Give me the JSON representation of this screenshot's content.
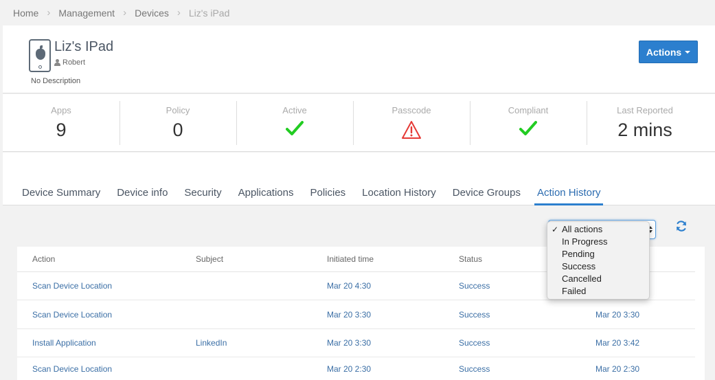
{
  "breadcrumb": [
    "Home",
    "Management",
    "Devices",
    "Liz's iPad"
  ],
  "device": {
    "name": "Liz's IPad",
    "owner": "Robert",
    "description": "No Description"
  },
  "actions_button": "Actions",
  "stats": [
    {
      "label": "Apps",
      "value": "9"
    },
    {
      "label": "Policy",
      "value": "0"
    },
    {
      "label": "Active",
      "icon": "green-check-icon"
    },
    {
      "label": "Passcode",
      "icon": "warning-triangle-icon"
    },
    {
      "label": "Compliant",
      "icon": "green-check-icon"
    },
    {
      "label": "Last Reported",
      "value": "2 mins"
    }
  ],
  "tabs": [
    "Device Summary",
    "Device info",
    "Security",
    "Applications",
    "Policies",
    "Location History",
    "Device Groups",
    "Action History"
  ],
  "active_tab": "Action History",
  "filter": {
    "selected": "All actions",
    "options": [
      "All actions",
      "In Progress",
      "Pending",
      "Success",
      "Cancelled",
      "Failed"
    ]
  },
  "table": {
    "headers": [
      "Action",
      "Subject",
      "Initiated time",
      "Status"
    ],
    "rows": [
      {
        "action": "Scan Device Location",
        "subject": "",
        "initiated": "Mar 20 4:30",
        "status": "Success",
        "completed": ""
      },
      {
        "action": "Scan Device Location",
        "subject": "",
        "initiated": "Mar 20 3:30",
        "status": "Success",
        "completed": "Mar 20 3:30"
      },
      {
        "action": "Install Application",
        "subject": "LinkedIn",
        "initiated": "Mar 20 3:30",
        "status": "Success",
        "completed": "Mar 20 3:42"
      },
      {
        "action": "Scan Device Location",
        "subject": "",
        "initiated": "Mar 20 2:30",
        "status": "Success",
        "completed": "Mar 20 2:30"
      }
    ]
  },
  "colors": {
    "primary": "#2c7fce",
    "check": "#22cc22",
    "warning": "#e53935",
    "link": "#3a6ea5"
  }
}
